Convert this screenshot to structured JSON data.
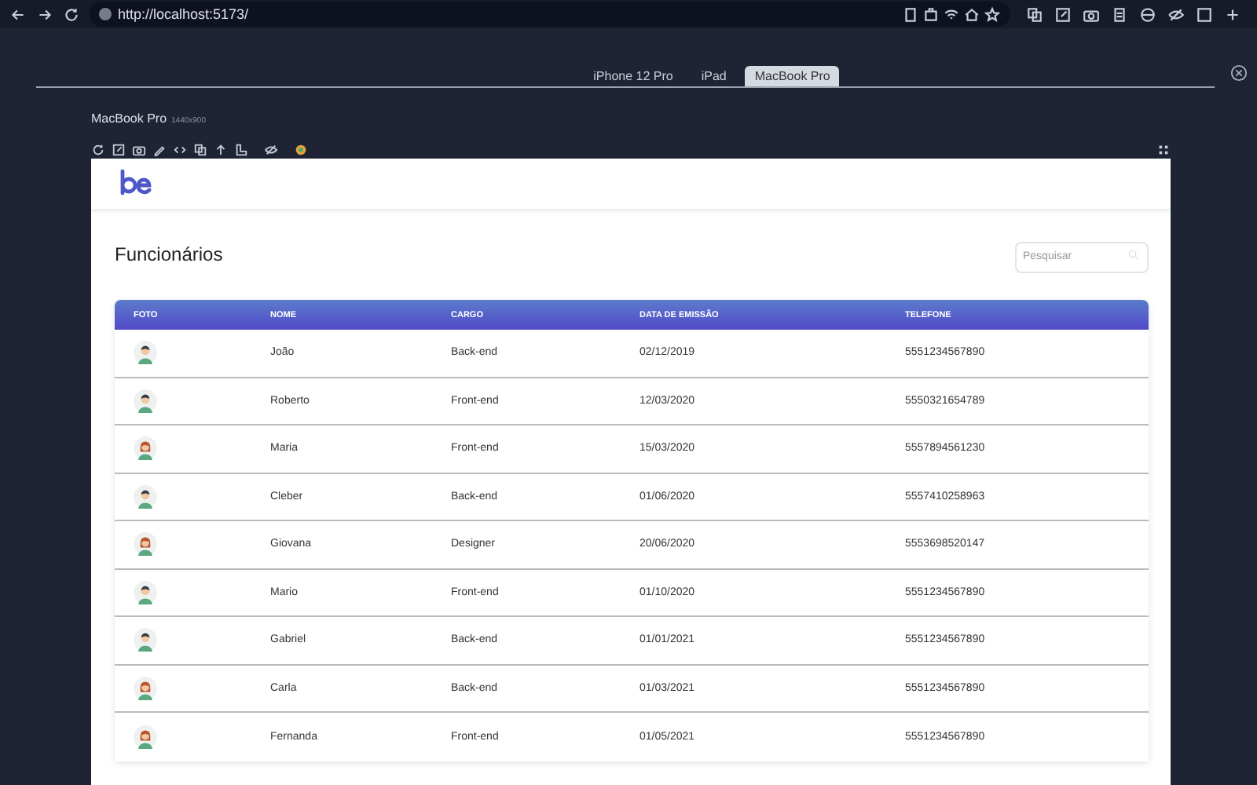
{
  "browser": {
    "url": "http://localhost:5173/"
  },
  "device_tabs": [
    {
      "label": "iPhone 12 Pro",
      "selected": false
    },
    {
      "label": "iPad",
      "selected": false
    },
    {
      "label": "MacBook Pro",
      "selected": true
    }
  ],
  "device": {
    "name": "MacBook Pro",
    "resolution": "1440x900"
  },
  "page": {
    "title": "Funcionários",
    "search": {
      "placeholder": "Pesquisar"
    },
    "table": {
      "columns": [
        "FOTO",
        "NOME",
        "CARGO",
        "DATA DE EMISSÃO",
        "TELEFONE"
      ],
      "rows": [
        {
          "kind": "male",
          "name": "João",
          "role": "Back-end",
          "date": "02/12/2019",
          "phone": "5551234567890"
        },
        {
          "kind": "male",
          "name": "Roberto",
          "role": "Front-end",
          "date": "12/03/2020",
          "phone": "5550321654789"
        },
        {
          "kind": "female",
          "name": "Maria",
          "role": "Front-end",
          "date": "15/03/2020",
          "phone": "5557894561230"
        },
        {
          "kind": "male",
          "name": "Cleber",
          "role": "Back-end",
          "date": "01/06/2020",
          "phone": "5557410258963"
        },
        {
          "kind": "female",
          "name": "Giovana",
          "role": "Designer",
          "date": "20/06/2020",
          "phone": "5553698520147"
        },
        {
          "kind": "male",
          "name": "Mario",
          "role": "Front-end",
          "date": "01/10/2020",
          "phone": "5551234567890"
        },
        {
          "kind": "male",
          "name": "Gabriel",
          "role": "Back-end",
          "date": "01/01/2021",
          "phone": "5551234567890"
        },
        {
          "kind": "female",
          "name": "Carla",
          "role": "Back-end",
          "date": "01/03/2021",
          "phone": "5551234567890"
        },
        {
          "kind": "female",
          "name": "Fernanda",
          "role": "Front-end",
          "date": "01/05/2021",
          "phone": "5551234567890"
        }
      ]
    }
  }
}
